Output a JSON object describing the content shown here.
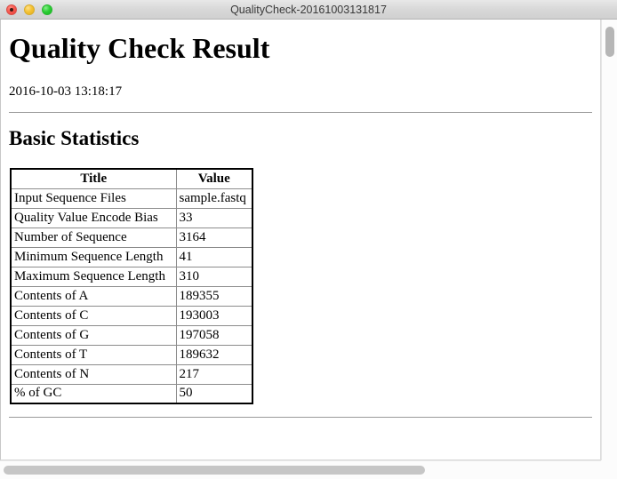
{
  "window": {
    "title": "QualityCheck-20161003131817",
    "traffic_lights": {
      "close_label": "",
      "minimize_label": "",
      "maximize_label": ""
    }
  },
  "document": {
    "title": "Quality Check Result",
    "timestamp": "2016-10-03 13:18:17",
    "section_title": "Basic Statistics"
  },
  "table": {
    "headers": [
      "Title",
      "Value"
    ],
    "rows": [
      {
        "title": "Input Sequence Files",
        "value": "sample.fastq"
      },
      {
        "title": "Quality Value Encode Bias",
        "value": "33"
      },
      {
        "title": "Number of Sequence",
        "value": "3164"
      },
      {
        "title": "Minimum Sequence Length",
        "value": "41"
      },
      {
        "title": "Maximum Sequence Length",
        "value": "310"
      },
      {
        "title": "Contents of A",
        "value": "189355"
      },
      {
        "title": "Contents of C",
        "value": "193003"
      },
      {
        "title": "Contents of G",
        "value": "197058"
      },
      {
        "title": "Contents of T",
        "value": "189632"
      },
      {
        "title": "Contents of N",
        "value": "217"
      },
      {
        "title": "% of GC",
        "value": "50"
      }
    ]
  },
  "colors": {
    "close": "#fa5b51",
    "minimize": "#f5c335",
    "maximize": "#2fce37",
    "titlebar": "#d8d8d8",
    "scrollbar_thumb": "#b6b6b6",
    "table_border": "#000000",
    "text": "#000000"
  },
  "scrollbars": {
    "vertical_icon": "vertical-scrollbar-thumb",
    "horizontal_icon": "horizontal-scrollbar-thumb"
  }
}
